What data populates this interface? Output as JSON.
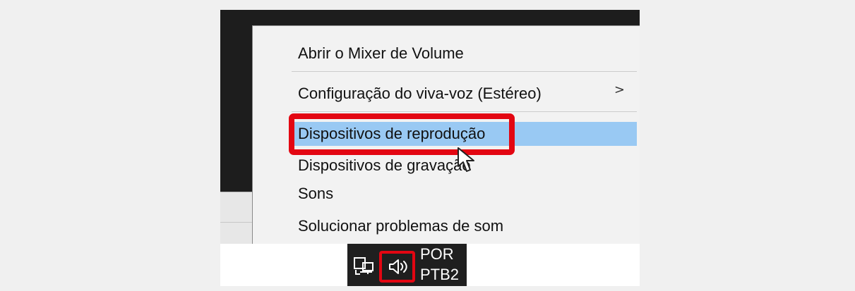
{
  "menu": {
    "items": [
      {
        "label": "Abrir o Mixer de Volume"
      },
      {
        "label": "Configuração do viva-voz (Estéreo)",
        "submenu_icon": "chevron-right-icon",
        "submenu_glyph": ">"
      },
      {
        "label": "Dispositivos de reprodução",
        "highlighted": true
      },
      {
        "label": "Dispositivos de gravação"
      },
      {
        "label": "Sons"
      },
      {
        "label": "Solucionar problemas de som"
      }
    ]
  },
  "taskbar": {
    "network_icon": "network-icon",
    "volume_icon": "volume-icon",
    "language": {
      "line1": "POR",
      "line2": "PTB2"
    }
  },
  "annotations": {
    "highlight_color": "#e30612",
    "menu_hover_color": "#99c9f3"
  }
}
